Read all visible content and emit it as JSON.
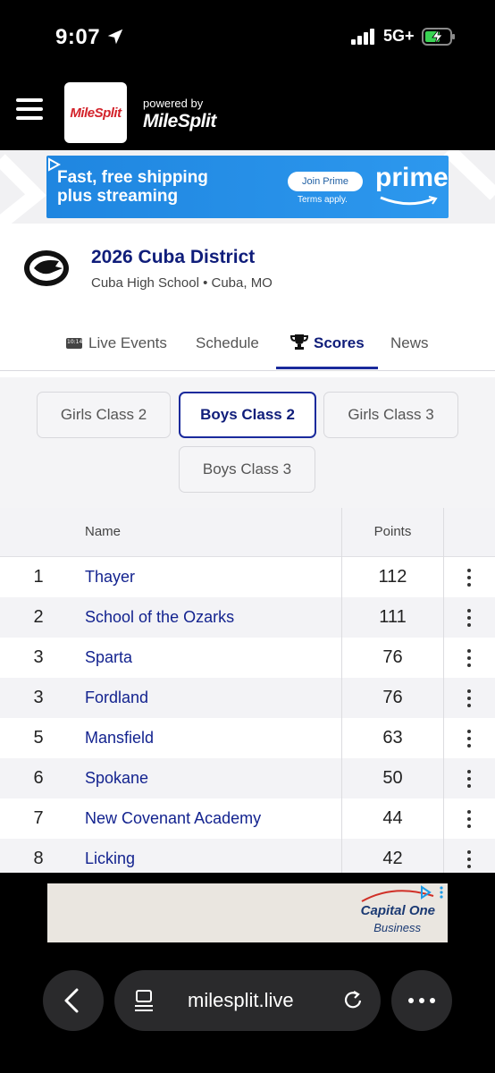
{
  "status_bar": {
    "time": "9:07",
    "network": "5G+"
  },
  "app_header": {
    "logo_text": "MileSplit",
    "powered_by": "powered by",
    "powered_logo": "MileSplit"
  },
  "ad_top": {
    "headline_line1": "Fast, free shipping",
    "headline_line2": "plus streaming",
    "cta": "Join Prime",
    "terms": "Terms apply.",
    "brand": "prime",
    "colors": {
      "background": "#1f86e0"
    }
  },
  "meet": {
    "title": "2026 Cuba District",
    "subtitle": "Cuba High School • Cuba, MO"
  },
  "tabs": [
    {
      "label": "Live Events",
      "icon": "live-clock-icon"
    },
    {
      "label": "Schedule"
    },
    {
      "label": "Scores",
      "icon": "trophy-icon",
      "active": true
    },
    {
      "label": "News"
    }
  ],
  "groups": [
    {
      "label": "Girls Class 2"
    },
    {
      "label": "Boys Class 2",
      "active": true
    },
    {
      "label": "Girls Class 3"
    },
    {
      "label": "Boys Class 3"
    }
  ],
  "table": {
    "headers": {
      "name": "Name",
      "points": "Points"
    },
    "rows": [
      {
        "rank": "1",
        "team": "Thayer",
        "points": "112"
      },
      {
        "rank": "2",
        "team": "School of the Ozarks",
        "points": "111"
      },
      {
        "rank": "3",
        "team": "Sparta",
        "points": "76"
      },
      {
        "rank": "3",
        "team": "Fordland",
        "points": "76"
      },
      {
        "rank": "5",
        "team": "Mansfield",
        "points": "63"
      },
      {
        "rank": "6",
        "team": "Spokane",
        "points": "50"
      },
      {
        "rank": "7",
        "team": "New Covenant Academy",
        "points": "44"
      },
      {
        "rank": "8",
        "team": "Licking",
        "points": "42"
      }
    ]
  },
  "ad_bottom": {
    "brand": "Capital One",
    "sub": "Business"
  },
  "browser": {
    "url": "milesplit.live"
  },
  "colors": {
    "accent": "#1a2a9c",
    "link": "#13238f",
    "brand_red": "#d3222a"
  }
}
